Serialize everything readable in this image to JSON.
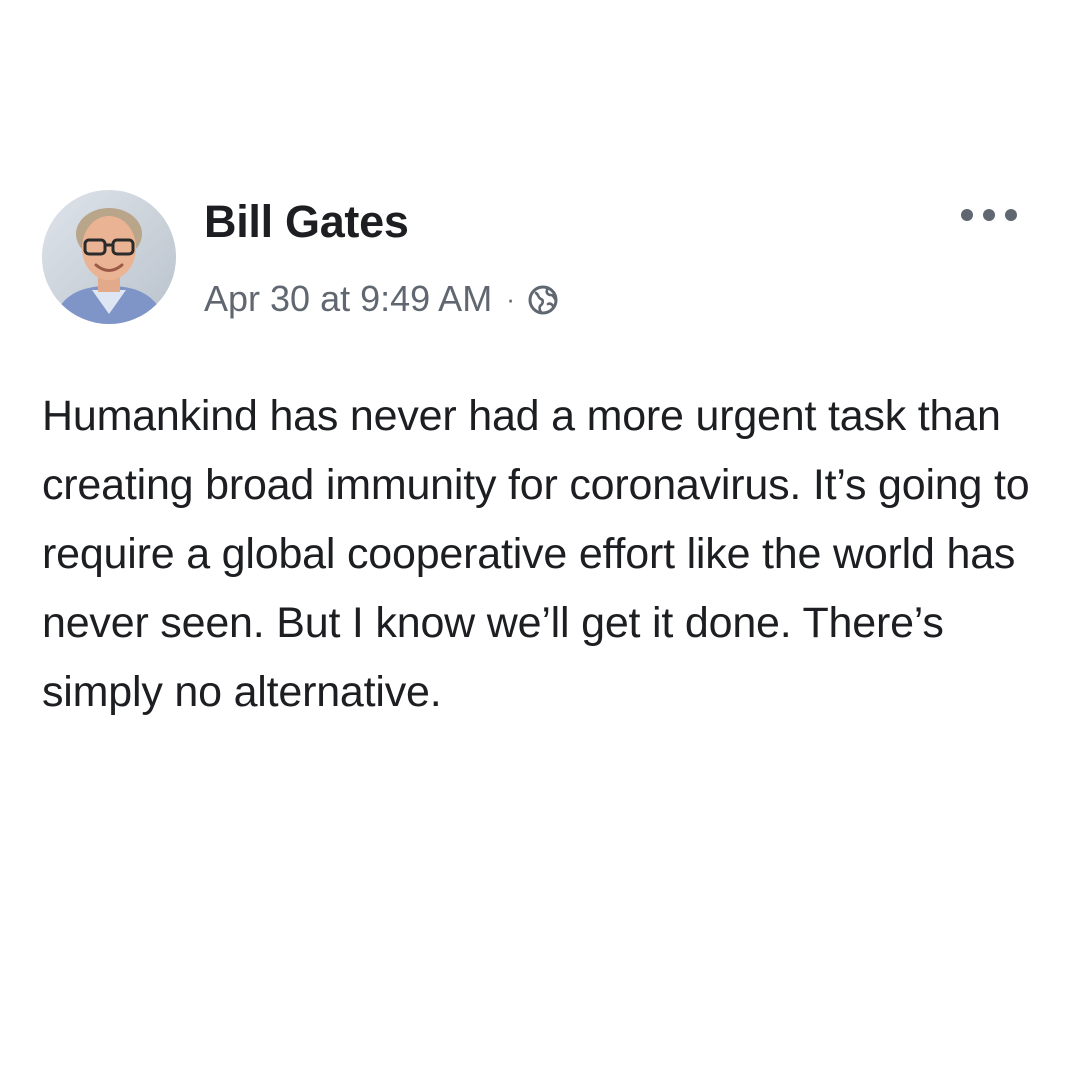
{
  "post": {
    "author": "Bill Gates",
    "timestamp": "Apr 30 at 9:49 AM",
    "separator": "·",
    "privacy_icon": "globe-icon",
    "more_icon": "more-options-icon",
    "avatar_icon": "profile-photo",
    "text": "Humankind has never had a more urgent task than creating broad immunity for coronavirus. It’s going to require a global cooperative effort like the world has never seen. But I know we’ll get it done. There’s simply no alternative."
  },
  "colors": {
    "background": "#ffffff",
    "primary_text": "#1c1e21",
    "secondary_text": "#606770"
  }
}
